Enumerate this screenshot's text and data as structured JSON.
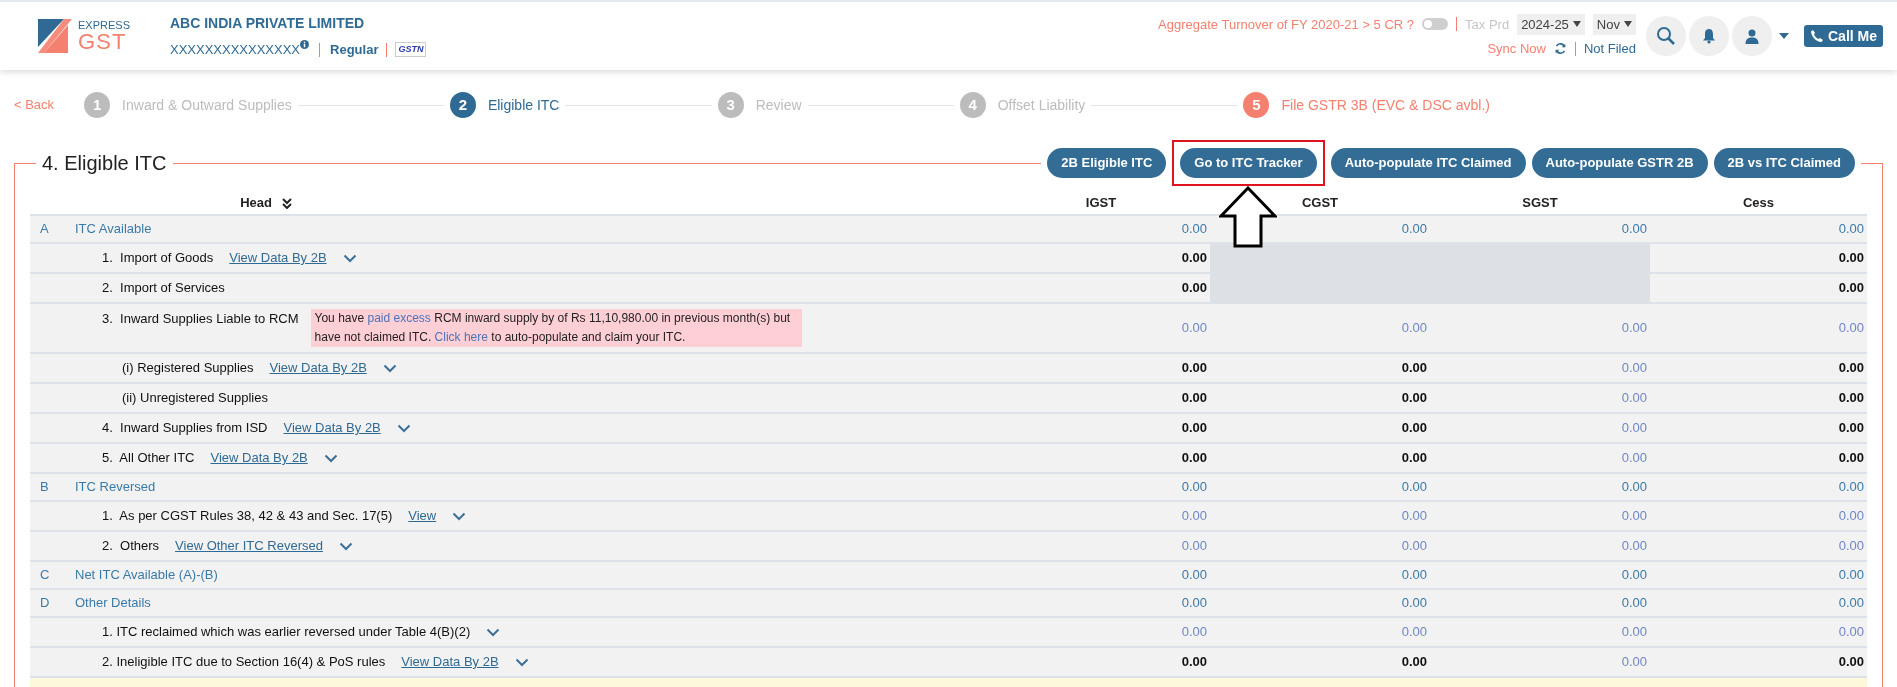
{
  "header": {
    "logo": {
      "top": "EXPRESS",
      "bottom": "GST"
    },
    "company": "ABC INDIA PRIVATE LIMITED",
    "gstin": "XXXXXXXXXXXXXXX",
    "registration": "Regular",
    "gstn_badge": "GSTN",
    "turnover_question": "Aggregate Turnover of FY 2020-21 > 5 CR ?",
    "turnover_toggle": {
      "on": false
    },
    "tax_period_label": "Tax Prd",
    "year": "2024-25",
    "month": "Nov",
    "sync": "Sync Now",
    "filing_status": "Not Filed",
    "call_button": "Call Me"
  },
  "back": "< Back",
  "steps": [
    {
      "number": "1",
      "label": "Inward & Outward Supplies",
      "color": "#bcbcbc"
    },
    {
      "number": "2",
      "label": "Eligible ITC",
      "color": "#2f6a94"
    },
    {
      "number": "3",
      "label": "Review",
      "color": "#bcbcbc"
    },
    {
      "number": "4",
      "label": "Offset Liability",
      "color": "#bcbcbc"
    },
    {
      "number": "5",
      "label": "File GSTR 3B (EVC & DSC avbl.)",
      "color": "#f4806f"
    }
  ],
  "section": {
    "title": "4. Eligible ITC",
    "buttons": [
      {
        "label": "2B Eligible ITC",
        "highlighted": false
      },
      {
        "label": "Go to ITC Tracker",
        "highlighted": true
      },
      {
        "label": "Auto-populate ITC Claimed",
        "highlighted": false
      },
      {
        "label": "Auto-populate GSTR 2B",
        "highlighted": false
      },
      {
        "label": "2B vs ITC Claimed",
        "highlighted": false
      }
    ]
  },
  "table": {
    "columns": [
      "Head",
      "IGST",
      "CGST",
      "SGST",
      "Cess"
    ],
    "rows": [
      {
        "kind": "section",
        "letter": "A",
        "label": "ITC Available",
        "cells": [
          {
            "value": "0.00",
            "kind": "total"
          },
          {
            "value": "0.00",
            "kind": "total"
          },
          {
            "value": "0.00",
            "kind": "total"
          },
          {
            "value": "0.00",
            "kind": "total"
          }
        ]
      },
      {
        "kind": "item",
        "label": "1.  Import of Goods",
        "link": "View Data By 2B",
        "expandable": true,
        "cells": [
          {
            "value": "0.00",
            "kind": "value"
          },
          {
            "kind": "blocked"
          },
          {
            "kind": "blocked"
          },
          {
            "value": "0.00",
            "kind": "value"
          }
        ]
      },
      {
        "kind": "item",
        "label": "2.  Import of Services",
        "expandable": false,
        "cells": [
          {
            "value": "0.00",
            "kind": "value"
          },
          {
            "kind": "blocked"
          },
          {
            "kind": "blocked"
          },
          {
            "value": "0.00",
            "kind": "value"
          }
        ]
      },
      {
        "kind": "item",
        "label": "3.  Inward Supplies Liable to RCM",
        "expandable": false,
        "notice": [
          {
            "text": "You have",
            "link": false
          },
          {
            "text": "paid excess",
            "link": true
          },
          {
            "text": "RCM inward supply by of Rs 11,10,980.00 in previous month(s) but have not claimed ITC.",
            "link": false
          },
          {
            "text": "Click here",
            "link": true
          },
          {
            "text": "to auto-populate and claim your ITC.",
            "link": false
          }
        ],
        "cells": [
          {
            "value": "0.00",
            "kind": "input"
          },
          {
            "value": "0.00",
            "kind": "input"
          },
          {
            "value": "0.00",
            "kind": "input"
          },
          {
            "value": "0.00",
            "kind": "input"
          }
        ],
        "children": [
          {
            "kind": "item",
            "label": "(i) Registered Supplies",
            "link": "View Data By 2B",
            "expandable": true,
            "cells": [
              {
                "value": "0.00",
                "kind": "value"
              },
              {
                "value": "0.00",
                "kind": "value"
              },
              {
                "value": "0.00",
                "kind": "input"
              },
              {
                "value": "0.00",
                "kind": "value"
              }
            ]
          },
          {
            "kind": "item",
            "label": "(ii) Unregistered Supplies",
            "expandable": false,
            "cells": [
              {
                "value": "0.00",
                "kind": "value"
              },
              {
                "value": "0.00",
                "kind": "value"
              },
              {
                "value": "0.00",
                "kind": "input"
              },
              {
                "value": "0.00",
                "kind": "value"
              }
            ]
          }
        ]
      },
      {
        "kind": "item",
        "label": "4.  Inward Supplies from ISD",
        "link": "View Data By 2B",
        "expandable": true,
        "cells": [
          {
            "value": "0.00",
            "kind": "value"
          },
          {
            "value": "0.00",
            "kind": "value"
          },
          {
            "value": "0.00",
            "kind": "input"
          },
          {
            "value": "0.00",
            "kind": "value"
          }
        ]
      },
      {
        "kind": "item",
        "label": "5.  All Other ITC",
        "link": "View Data By 2B",
        "expandable": true,
        "cells": [
          {
            "value": "0.00",
            "kind": "value"
          },
          {
            "value": "0.00",
            "kind": "value"
          },
          {
            "value": "0.00",
            "kind": "input"
          },
          {
            "value": "0.00",
            "kind": "value"
          }
        ]
      },
      {
        "kind": "section",
        "letter": "B",
        "label": "ITC Reversed",
        "cells": [
          {
            "value": "0.00",
            "kind": "total"
          },
          {
            "value": "0.00",
            "kind": "total"
          },
          {
            "value": "0.00",
            "kind": "total"
          },
          {
            "value": "0.00",
            "kind": "total"
          }
        ]
      },
      {
        "kind": "item",
        "label": "1.  As per CGST Rules 38, 42 & 43 and Sec. 17(5)",
        "link": "View",
        "expandable": true,
        "cells": [
          {
            "value": "0.00",
            "kind": "input"
          },
          {
            "value": "0.00",
            "kind": "input"
          },
          {
            "value": "0.00",
            "kind": "input"
          },
          {
            "value": "0.00",
            "kind": "input"
          }
        ]
      },
      {
        "kind": "item",
        "label": "2.  Others",
        "link": "View Other ITC Reversed",
        "expandable": true,
        "cells": [
          {
            "value": "0.00",
            "kind": "input"
          },
          {
            "value": "0.00",
            "kind": "input"
          },
          {
            "value": "0.00",
            "kind": "input"
          },
          {
            "value": "0.00",
            "kind": "input"
          }
        ]
      },
      {
        "kind": "section",
        "letter": "C",
        "label": "Net ITC Available (A)-(B)",
        "cells": [
          {
            "value": "0.00",
            "kind": "total"
          },
          {
            "value": "0.00",
            "kind": "total"
          },
          {
            "value": "0.00",
            "kind": "total"
          },
          {
            "value": "0.00",
            "kind": "total"
          }
        ]
      },
      {
        "kind": "section",
        "letter": "D",
        "label": "Other Details",
        "cells": [
          {
            "value": "0.00",
            "kind": "total"
          },
          {
            "value": "0.00",
            "kind": "total"
          },
          {
            "value": "0.00",
            "kind": "total"
          },
          {
            "value": "0.00",
            "kind": "total"
          }
        ]
      },
      {
        "kind": "item",
        "label": "1. ITC reclaimed which was earlier reversed under Table 4(B)(2)",
        "expandable": true,
        "cells": [
          {
            "value": "0.00",
            "kind": "input"
          },
          {
            "value": "0.00",
            "kind": "input"
          },
          {
            "value": "0.00",
            "kind": "input"
          },
          {
            "value": "0.00",
            "kind": "input"
          }
        ]
      },
      {
        "kind": "item",
        "label": "2. Ineligible ITC due to Section 16(4) & PoS rules",
        "link": "View Data By 2B",
        "expandable": true,
        "cells": [
          {
            "value": "0.00",
            "kind": "value"
          },
          {
            "value": "0.00",
            "kind": "value"
          },
          {
            "value": "0.00",
            "kind": "input"
          },
          {
            "value": "0.00",
            "kind": "value"
          }
        ]
      }
    ]
  }
}
